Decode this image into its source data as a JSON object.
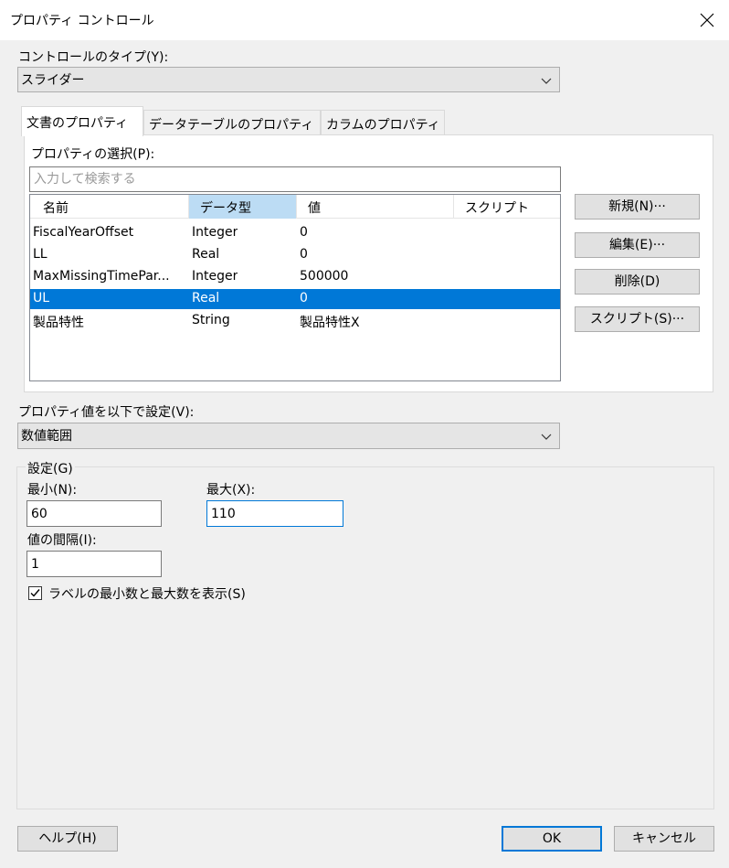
{
  "window": {
    "title": "プロパティ コントロール"
  },
  "control_type": {
    "label": "コントロールのタイプ(Y):",
    "value": "スライダー"
  },
  "tabs": [
    {
      "label": "文書のプロパティ",
      "active": true
    },
    {
      "label": "データテーブルのプロパティ",
      "active": false
    },
    {
      "label": "カラムのプロパティ",
      "active": false
    }
  ],
  "property_select": {
    "label": "プロパティの選択(P):",
    "search_placeholder": "入力して検索する",
    "columns": [
      "名前",
      "データ型",
      "値",
      "スクリプト"
    ],
    "rows": [
      {
        "name": "FiscalYearOffset",
        "type": "Integer",
        "value": "0",
        "script": ""
      },
      {
        "name": "LL",
        "type": "Real",
        "value": "0",
        "script": ""
      },
      {
        "name": "MaxMissingTimePar...",
        "type": "Integer",
        "value": "500000",
        "script": ""
      },
      {
        "name": "UL",
        "type": "Real",
        "value": "0",
        "script": "",
        "selected": true
      },
      {
        "name": "製品特性",
        "type": "String",
        "value": "製品特性X",
        "script": ""
      }
    ]
  },
  "side_buttons": {
    "new": "新規(N)···",
    "edit": "編集(E)···",
    "delete": "削除(D)",
    "script": "スクリプト(S)···"
  },
  "property_value": {
    "label": "プロパティ値を以下で設定(V):",
    "value": "数値範囲"
  },
  "settings": {
    "legend": "設定(G)",
    "min_label": "最小(N):",
    "min_value": "60",
    "max_label": "最大(X):",
    "max_value": "110",
    "interval_label": "値の間隔(I):",
    "interval_value": "1",
    "show_minmax_label": "ラベルの最小数と最大数を表示(S)",
    "show_minmax_checked": true
  },
  "footer": {
    "help": "ヘルプ(H)",
    "ok": "OK",
    "cancel": "キャンセル"
  }
}
